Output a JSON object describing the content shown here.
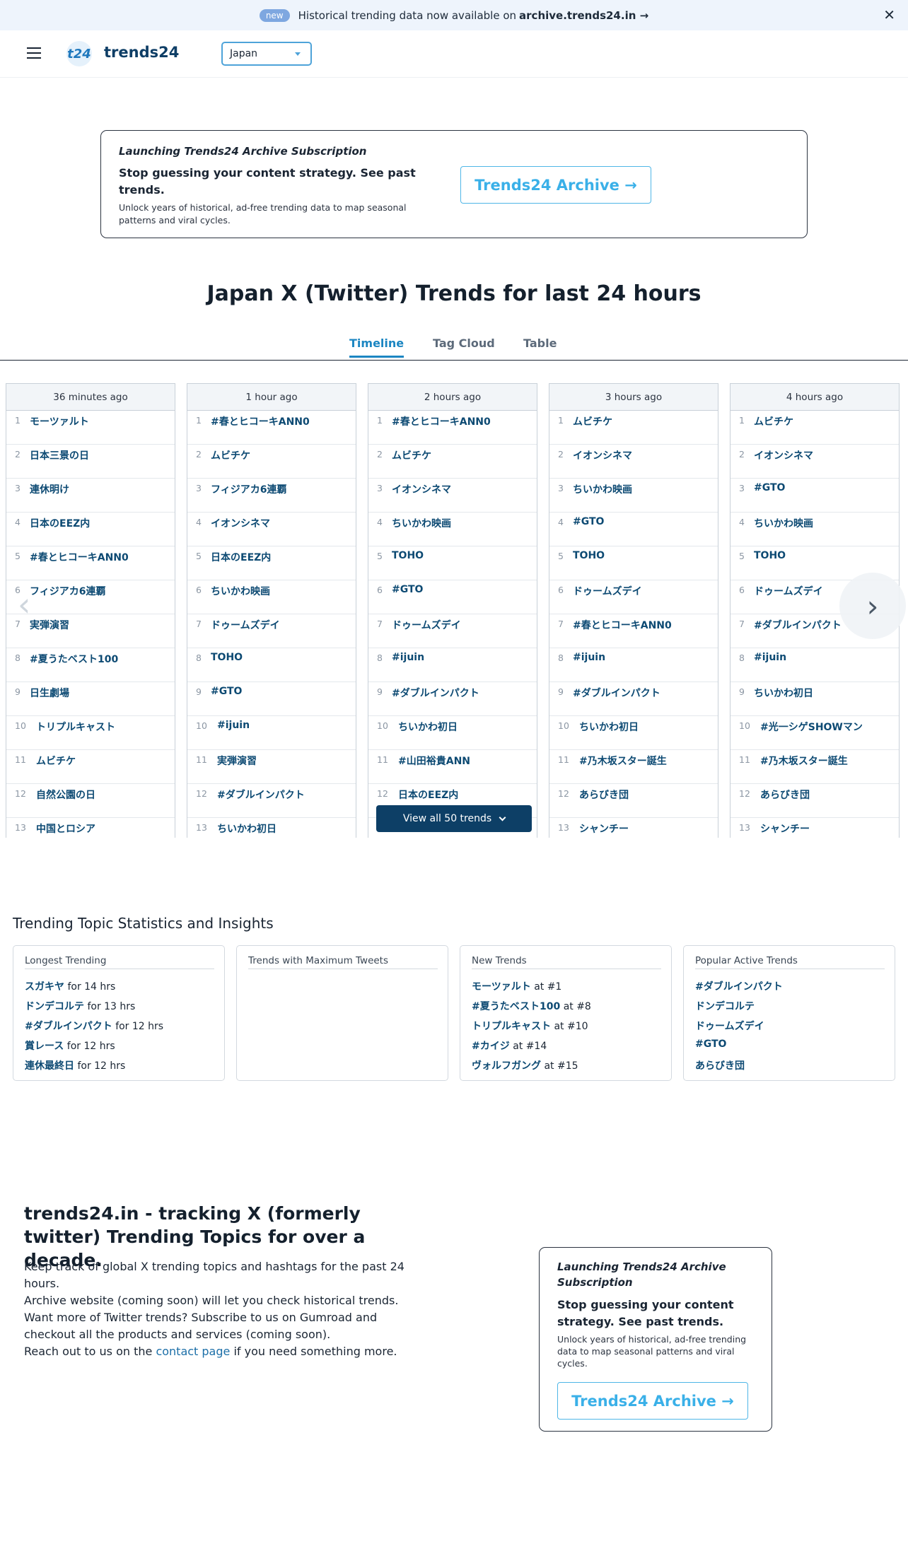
{
  "announcement": {
    "badge": "new",
    "text": "Historical trending data now available on",
    "link": "archive.trends24.in →"
  },
  "header": {
    "logo_mark": "t24",
    "logo_text": "trends24",
    "country": "Japan"
  },
  "promo": {
    "title": "Launching Trends24 Archive Subscription",
    "headline": "Stop guessing your content strategy. See past trends.",
    "description": "Unlock years of historical, ad-free trending data to map seasonal patterns and viral cycles.",
    "button": "Trends24 Archive →"
  },
  "page_title": "Japan X (Twitter) Trends for last 24 hours",
  "tabs": [
    "Timeline",
    "Tag Cloud",
    "Table"
  ],
  "timeline": [
    {
      "time": "36 minutes ago",
      "trends": [
        "モーツァルト",
        "日本三景の日",
        "連休明け",
        "日本のEEZ内",
        "#春とヒコーキANN0",
        "フィジアカ6連覇",
        "実弾演習",
        "#夏うたベスト100",
        "日生劇場",
        "トリプルキャスト",
        "ムビチケ",
        "自然公園の日",
        "中国とロシア"
      ]
    },
    {
      "time": "1 hour ago",
      "trends": [
        "#春とヒコーキANN0",
        "ムビチケ",
        "フィジアカ6連覇",
        "イオンシネマ",
        "日本のEEZ内",
        "ちいかわ映画",
        "ドゥームズデイ",
        "TOHO",
        "#GTO",
        "#ijuin",
        "実弾演習",
        "#ダブルインパクト",
        "ちいかわ初日"
      ]
    },
    {
      "time": "2 hours ago",
      "trends": [
        "#春とヒコーキANN0",
        "ムビチケ",
        "イオンシネマ",
        "ちいかわ映画",
        "TOHO",
        "#GTO",
        "ドゥームズデイ",
        "#ijuin",
        "#ダブルインパクト",
        "ちいかわ初日",
        "#山田裕貴ANN",
        "日本のEEZ内",
        ""
      ]
    },
    {
      "time": "3 hours ago",
      "trends": [
        "ムビチケ",
        "イオンシネマ",
        "ちいかわ映画",
        "#GTO",
        "TOHO",
        "ドゥームズデイ",
        "#春とヒコーキANN0",
        "#ijuin",
        "#ダブルインパクト",
        "ちいかわ初日",
        "#乃木坂スター誕生",
        "あらびき団",
        "シャンチー"
      ]
    },
    {
      "time": "4 hours ago",
      "trends": [
        "ムビチケ",
        "イオンシネマ",
        "#GTO",
        "ちいかわ映画",
        "TOHO",
        "ドゥームズデイ",
        "#ダブルインパクト",
        "#ijuin",
        "ちいかわ初日",
        "#光一シゲSHOWマン",
        "#乃木坂スター誕生",
        "あらびき団",
        "シャンチー"
      ]
    }
  ],
  "view_all": "View all 50 trends",
  "stats": {
    "title": "Trending Topic Statistics and Insights",
    "cards": [
      {
        "heading": "Longest Trending",
        "items": [
          {
            "name": "スガキヤ",
            "suffix": "for 14 hrs"
          },
          {
            "name": "ドンデコルテ",
            "suffix": "for 13 hrs"
          },
          {
            "name": "#ダブルインパクト",
            "suffix": "for 12 hrs"
          },
          {
            "name": "賞レース",
            "suffix": "for 12 hrs"
          },
          {
            "name": "連休最終日",
            "suffix": "for 12 hrs"
          }
        ]
      },
      {
        "heading": "Trends with Maximum Tweets",
        "items": []
      },
      {
        "heading": "New Trends",
        "items": [
          {
            "name": "モーツァルト",
            "suffix": "at #1"
          },
          {
            "name": "#夏うたベスト100",
            "suffix": "at #8"
          },
          {
            "name": "トリプルキャスト",
            "suffix": "at #10"
          },
          {
            "name": "#カイジ",
            "suffix": "at #14"
          },
          {
            "name": "ヴォルフガング",
            "suffix": "at #15"
          }
        ]
      },
      {
        "heading": "Popular Active Trends",
        "items": [
          {
            "name": "#ダブルインパクト",
            "suffix": ""
          },
          {
            "name": "ドンデコルテ",
            "suffix": ""
          },
          {
            "name": "ドゥームズデイ",
            "suffix": ""
          },
          {
            "name": "#GTO",
            "suffix": ""
          },
          {
            "name": "あらびき団",
            "suffix": ""
          }
        ]
      }
    ]
  },
  "footer": {
    "title": "trends24.in - tracking X (formerly twitter) Trending Topics for over a decade.",
    "line1": "Keep track of global X trending topics and hashtags for the past 24 hours.",
    "line2": "Archive website (coming soon) will let you check historical trends.",
    "line3": "Want more of Twitter trends? Subscribe to us on Gumroad and checkout all the products and services (coming soon).",
    "line4_pre": "Reach out to us on the",
    "line4_link": "contact page",
    "line4_post": "if you need something more."
  },
  "icons": {
    "close": "close-icon",
    "menu": "hamburger-icon",
    "prev": "chevron-left-icon",
    "next": "chevron-right-icon",
    "dropdown": "caret-down-icon"
  }
}
